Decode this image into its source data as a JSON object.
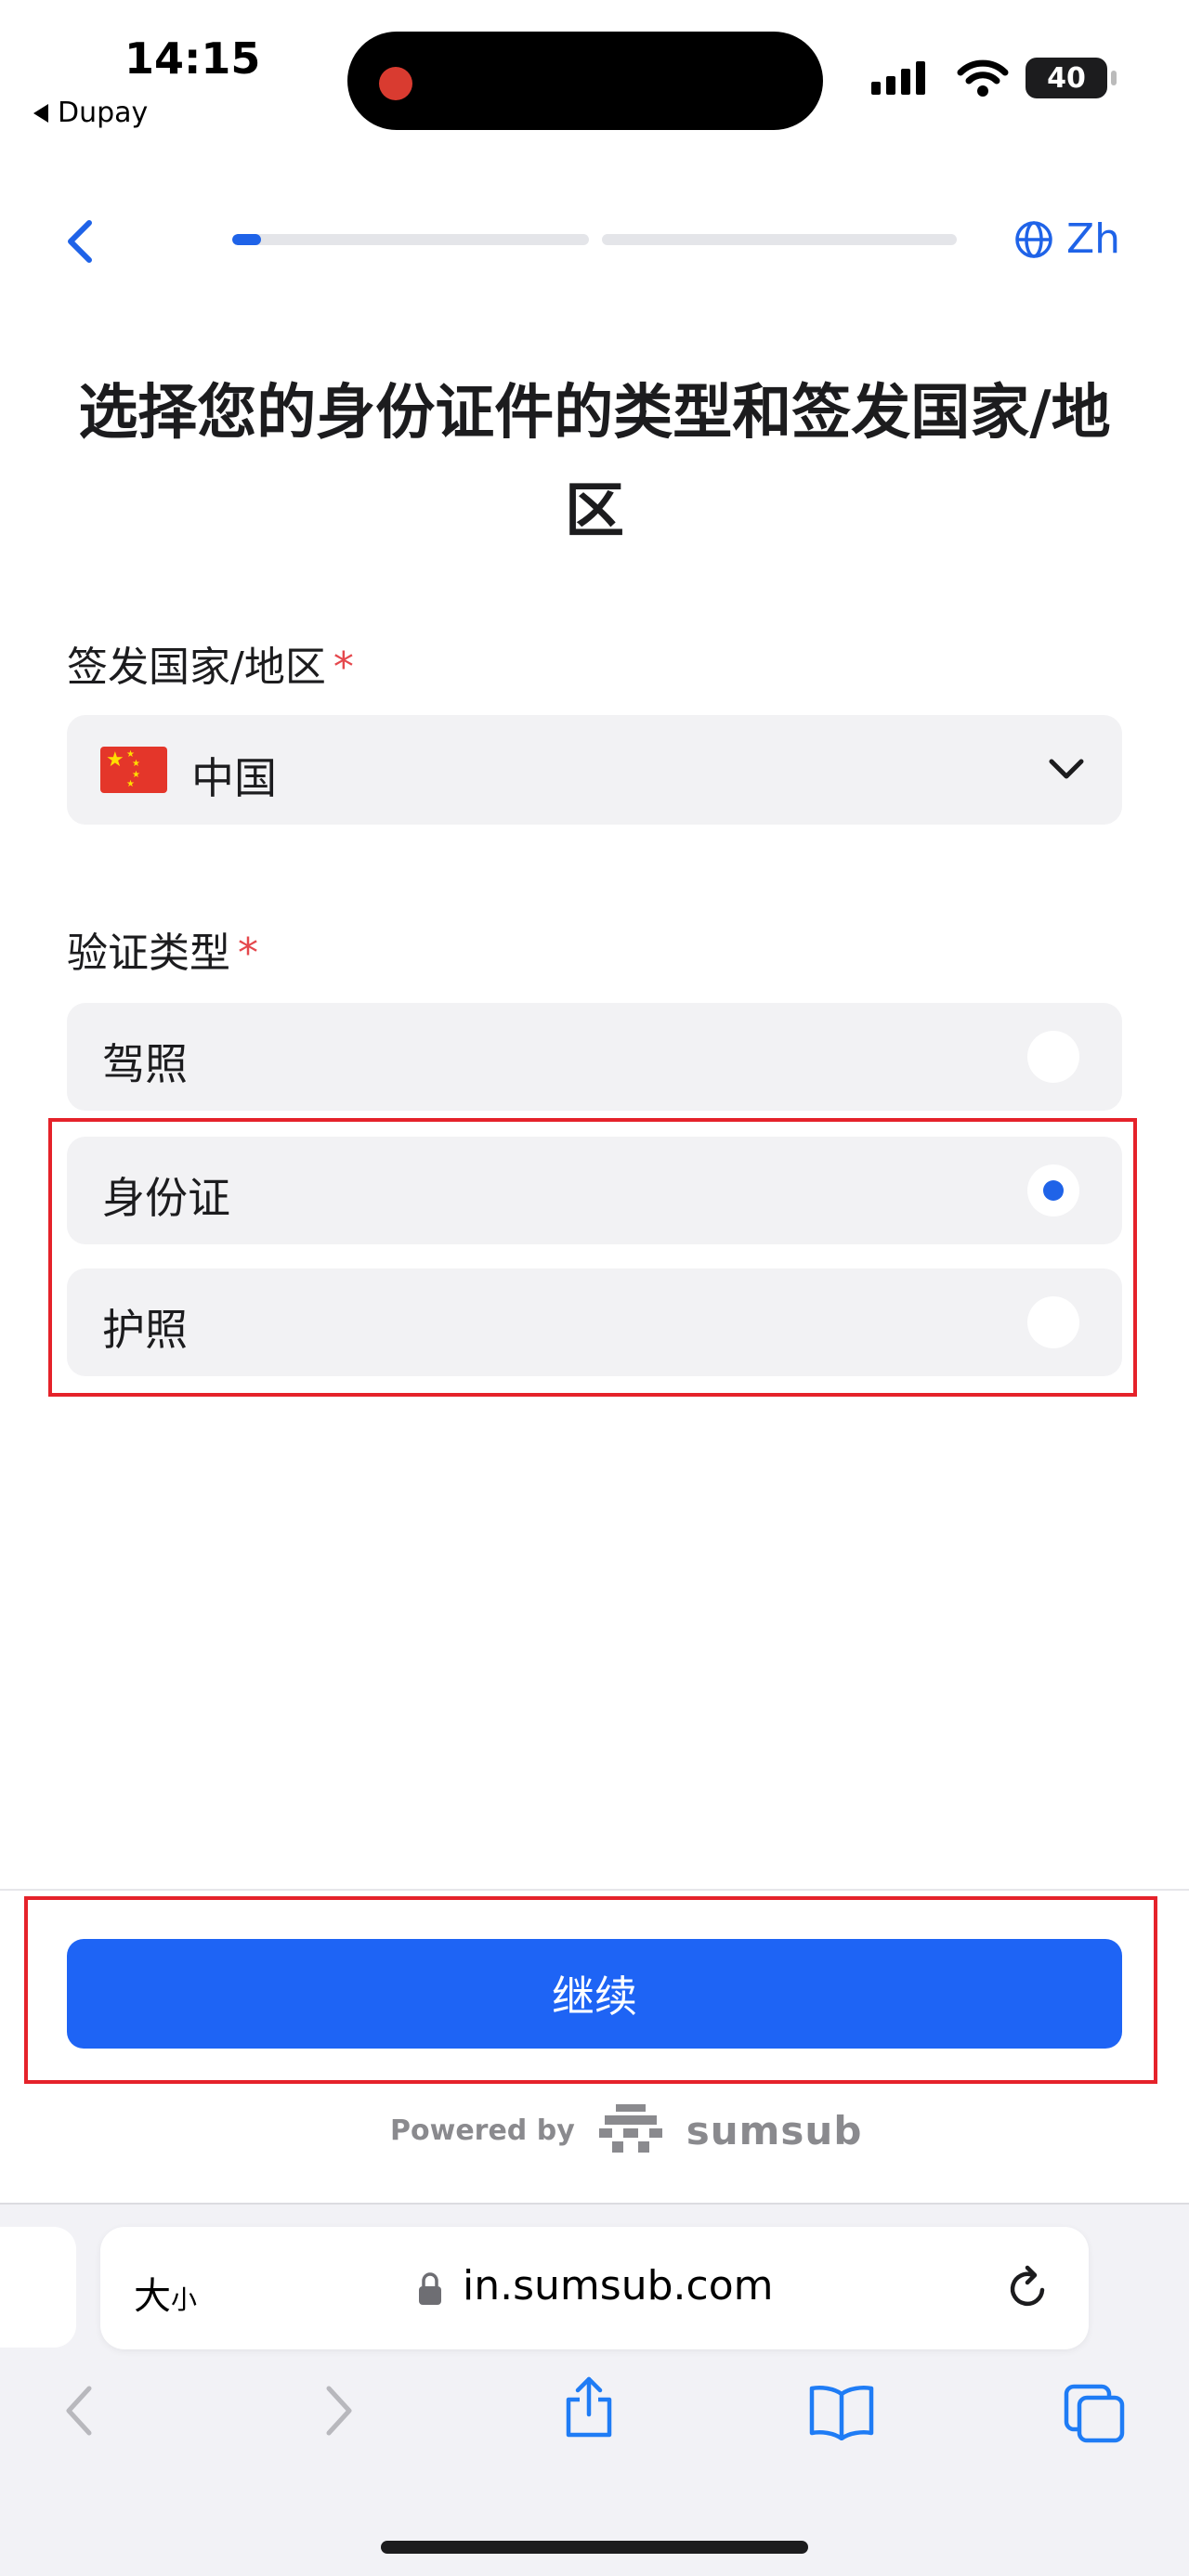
{
  "status_bar": {
    "time": "14:15",
    "back_app": "Dupay",
    "battery": "40"
  },
  "header": {
    "back_icon": "chevron-left-icon",
    "progress": [
      {
        "fill_fraction": 0.08
      },
      {
        "fill_fraction": 0.0
      }
    ],
    "language": "Zh",
    "language_icon": "globe-icon"
  },
  "page": {
    "title": "选择您的身份证件的类型和签发国家/地区"
  },
  "country": {
    "label": "签发国家/地区",
    "required_mark": "*",
    "selected": "中国",
    "flag": "china-flag"
  },
  "doc_type": {
    "label": "验证类型",
    "required_mark": "*",
    "options": [
      {
        "label": "驾照",
        "selected": false
      },
      {
        "label": "身份证",
        "selected": true
      },
      {
        "label": "护照",
        "selected": false
      }
    ]
  },
  "footer": {
    "continue_label": "继续",
    "powered_by": "Powered by",
    "brand": "sumsub"
  },
  "browser": {
    "text_size_label": "大",
    "text_size_small": "小",
    "url": "in.sumsub.com"
  },
  "colors": {
    "accent": "#1f63e8",
    "button": "#1e64f5",
    "required": "#e5484d",
    "highlight": "#e5222a"
  }
}
